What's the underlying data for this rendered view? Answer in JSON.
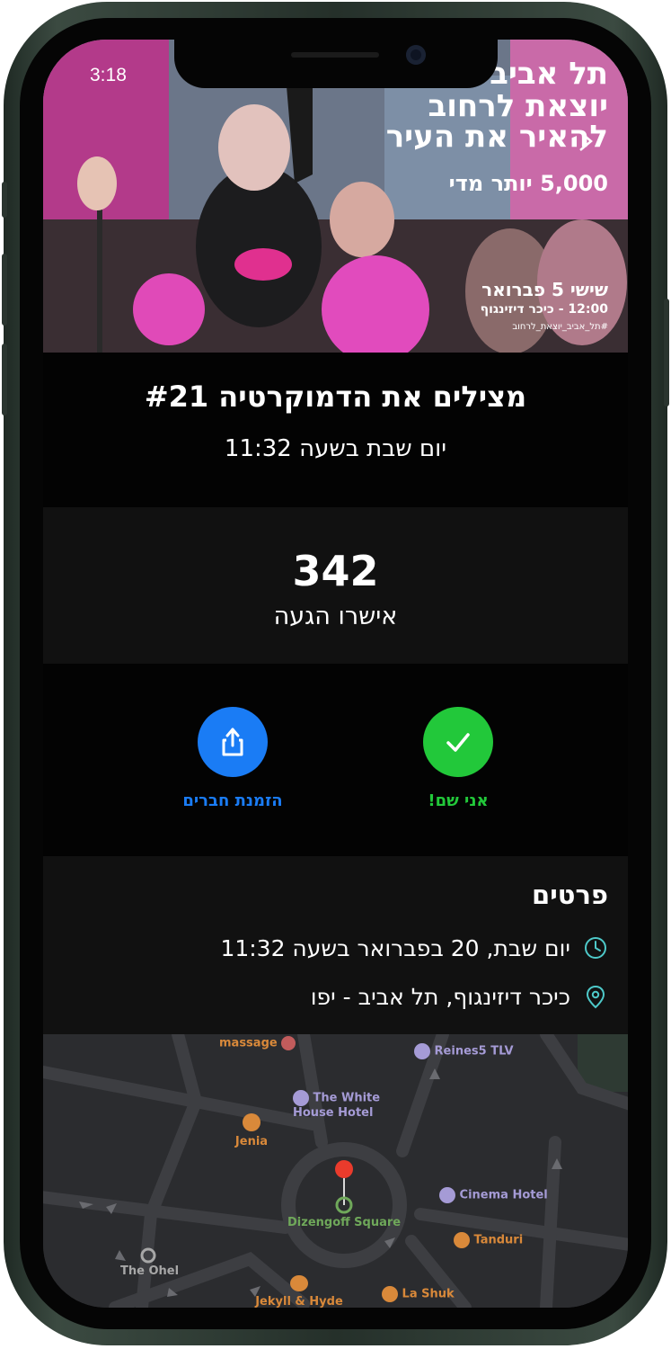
{
  "status_bar": {
    "time": "3:18"
  },
  "banner": {
    "line1": "תל אביב",
    "line2": "יוצאת לרחוב",
    "line3": "להאיר את העיר",
    "line4": "5,000 יותר מדי",
    "line5": "שישי 5 פברואר",
    "line6": "12:00 - כיכר דיזינגוף",
    "hashtag": "#תל_אביב_יוצאת_לרחוב"
  },
  "event": {
    "title": "מצילים את הדמוקרטיה #21",
    "time": "יום שבת בשעה 11:32"
  },
  "attendance": {
    "count": "342",
    "label": "אישרו הגעה"
  },
  "actions": {
    "attend_label": "אני שם!",
    "invite_label": "הזמנת חברים"
  },
  "details": {
    "heading": "פרטים",
    "datetime": "יום שבת, 20 בפברואר בשעה 11:32",
    "location": "כיכר דיזינגוף, תל אביב - יפו"
  },
  "map": {
    "pois": [
      {
        "name": "massage"
      },
      {
        "name": "Reines5 TLV"
      },
      {
        "name": "The White House Hotel"
      },
      {
        "name": "Jenia"
      },
      {
        "name": "Dizengoff Square"
      },
      {
        "name": "Cinema Hotel"
      },
      {
        "name": "Tanduri"
      },
      {
        "name": "The Ohel"
      },
      {
        "name": "Jekyll & Hyde"
      },
      {
        "name": "La Shuk"
      }
    ]
  },
  "colors": {
    "attend_green": "#22c83a",
    "invite_blue": "#1a7cf5",
    "detail_icon": "#4ec9c9",
    "map_hotel": "#a59bd6",
    "map_food": "#d9893a",
    "map_square": "#6fa85a"
  }
}
